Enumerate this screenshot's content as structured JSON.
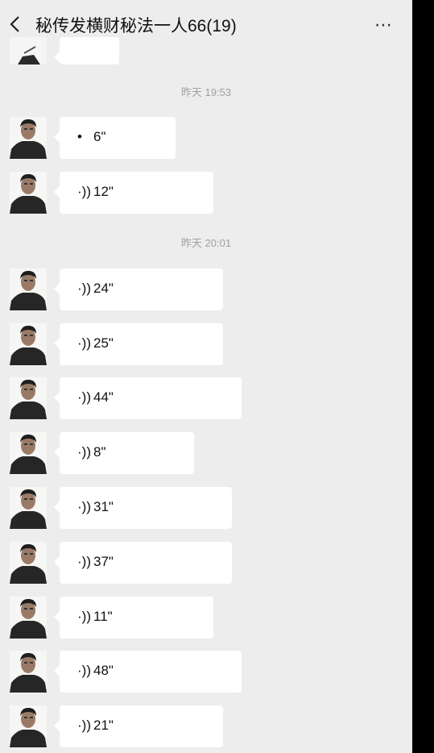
{
  "header": {
    "title": "秘传发横财秘法一人66(19)",
    "more_icon": "⋯"
  },
  "timestamps": [
    "昨天 19:53",
    "昨天 20:01"
  ],
  "messages_group1": [
    {
      "icon": "•",
      "duration": "6\""
    },
    {
      "icon": "·))",
      "duration": "12\""
    }
  ],
  "messages_group2": [
    {
      "icon": "·))",
      "duration": "24\""
    },
    {
      "icon": "·))",
      "duration": "25\""
    },
    {
      "icon": "·))",
      "duration": "44\""
    },
    {
      "icon": "·))",
      "duration": "8\""
    },
    {
      "icon": "·))",
      "duration": "31\""
    },
    {
      "icon": "·))",
      "duration": "37\""
    },
    {
      "icon": "·))",
      "duration": "11\""
    },
    {
      "icon": "·))",
      "duration": "48\""
    },
    {
      "icon": "·))",
      "duration": "21\""
    }
  ],
  "colors": {
    "background": "#ededed",
    "bubble": "#ffffff",
    "text": "#111111",
    "timestamp": "#a0a0a0"
  }
}
